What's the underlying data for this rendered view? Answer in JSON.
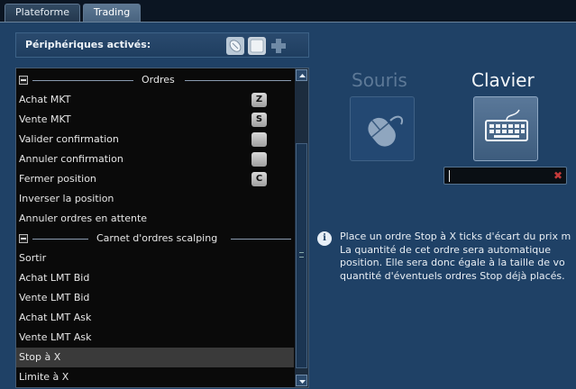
{
  "tabs": [
    {
      "label": "Plateforme"
    },
    {
      "label": "Trading"
    }
  ],
  "devices_bar": {
    "label": "Périphériques activés:",
    "icons": [
      "mouse-icon",
      "keyboard-icon",
      "gamepad-icon"
    ]
  },
  "list": {
    "sections": [
      {
        "title": "Ordres",
        "items": [
          {
            "label": "Achat MKT",
            "key": "Z"
          },
          {
            "label": "Vente MKT",
            "key": "S"
          },
          {
            "label": "Valider confirmation",
            "key": ""
          },
          {
            "label": "Annuler confirmation",
            "key": ""
          },
          {
            "label": "Fermer position",
            "key": "C"
          },
          {
            "label": "Inverser la position"
          },
          {
            "label": "Annuler ordres en attente"
          }
        ]
      },
      {
        "title": "Carnet d'ordres scalping",
        "items": [
          {
            "label": "Sortir"
          },
          {
            "label": "Achat LMT Bid"
          },
          {
            "label": "Vente LMT Bid"
          },
          {
            "label": "Achat LMT Ask"
          },
          {
            "label": "Vente LMT Ask"
          },
          {
            "label": "Stop à X",
            "selected": true
          },
          {
            "label": "Limite à X"
          }
        ]
      }
    ]
  },
  "devices": {
    "souris": "Souris",
    "clavier": "Clavier"
  },
  "key_input": {
    "value": ""
  },
  "description": [
    "Place un ordre Stop à X ticks d'écart du prix m",
    "La quantité de cet ordre sera automatique",
    "position. Elle sera donc égale à la taille de vo",
    "quantité d'éventuels ordres Stop déjà placés."
  ],
  "colors": {
    "background": "#1f4166",
    "list_bg": "#0a0a0a",
    "selected_row": "#3a3a3a",
    "clear_x": "#c43a3a"
  }
}
